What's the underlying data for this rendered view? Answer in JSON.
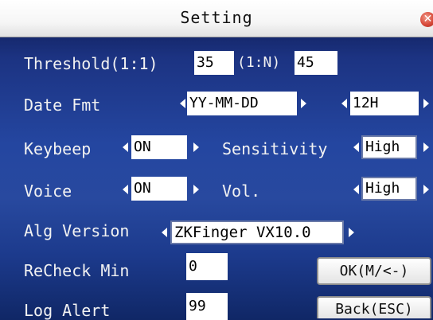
{
  "title": "Setting",
  "close_icon": "close-icon",
  "threshold": {
    "label": "Threshold(1:1)",
    "one_to_one": "35",
    "n_label": "(1:N)",
    "one_to_n": "45"
  },
  "date_fmt": {
    "label": "Date Fmt",
    "format": "YY-MM-DD",
    "hour": "12H"
  },
  "keybeep": {
    "label": "Keybeep",
    "value": "ON"
  },
  "sensitivity": {
    "label": "Sensitivity",
    "value": "High"
  },
  "voice": {
    "label": "Voice",
    "value": "ON"
  },
  "vol": {
    "label": "Vol.",
    "value": "High"
  },
  "alg_version": {
    "label": "Alg Version",
    "value": "ZKFinger VX10.0"
  },
  "recheck_min": {
    "label": "ReCheck Min",
    "value": "0"
  },
  "log_alert": {
    "label": "Log Alert",
    "value": "99"
  },
  "buttons": {
    "ok": "OK(M/<-)",
    "back": "Back(ESC)"
  }
}
